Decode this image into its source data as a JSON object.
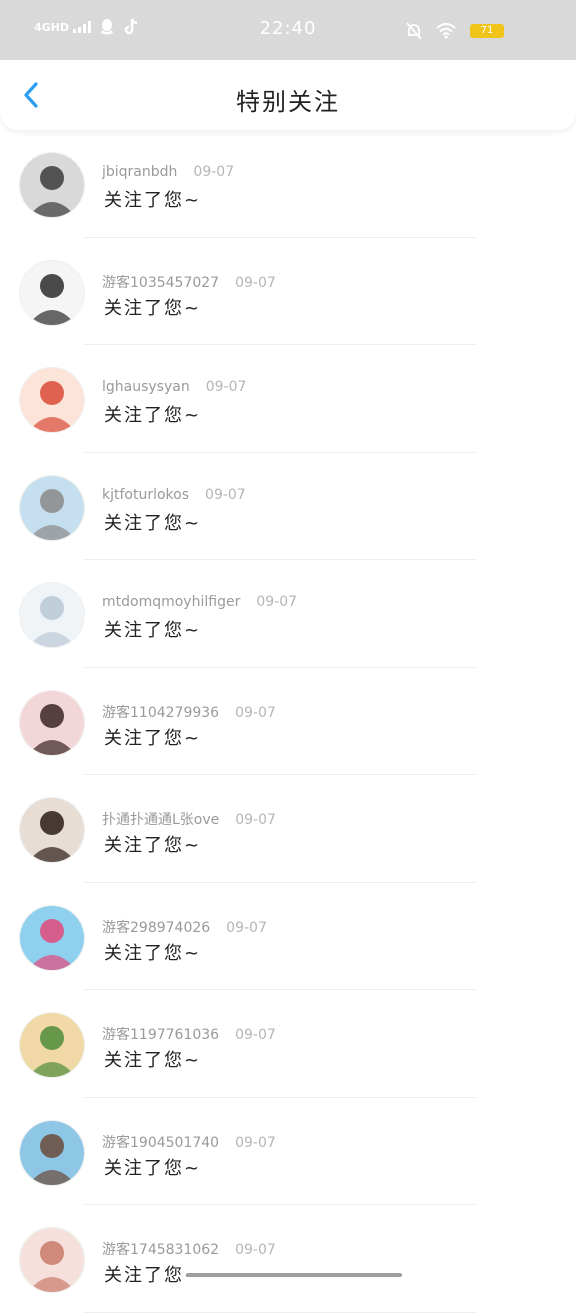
{
  "status_bar": {
    "network": "4GHD",
    "time": "22:40",
    "battery": "71",
    "colors": {
      "bg": "#d9d9d9",
      "battery": "#f0c419"
    }
  },
  "header": {
    "title": "特别关注",
    "accent": "#2a9df4"
  },
  "list": [
    {
      "name": "jbiqranbdh",
      "date": "09-07",
      "message": "关注了您~",
      "avatar_colors": [
        "#d9d9d9",
        "#3a3a3a"
      ]
    },
    {
      "name": "游客1035457027",
      "date": "09-07",
      "message": "关注了您~",
      "avatar_colors": [
        "#f5f5f5",
        "#2b2b2b"
      ]
    },
    {
      "name": "lghausysyan",
      "date": "09-07",
      "message": "关注了您~",
      "avatar_colors": [
        "#fde4d8",
        "#d94b3a"
      ]
    },
    {
      "name": "kjtfoturlokos",
      "date": "09-07",
      "message": "关注了您~",
      "avatar_colors": [
        "#c5dff0",
        "#8a8a8a"
      ]
    },
    {
      "name": "mtdomqmoyhilfiger",
      "date": "09-07",
      "message": "关注了您~",
      "avatar_colors": [
        "#f0f4f7",
        "#b9c8d6"
      ]
    },
    {
      "name": "游客1104279936",
      "date": "09-07",
      "message": "关注了您~",
      "avatar_colors": [
        "#f3d7d8",
        "#3a2424"
      ]
    },
    {
      "name": "扑通扑通通L张ove",
      "date": "09-07",
      "message": "关注了您~",
      "avatar_colors": [
        "#e8ddd4",
        "#2a1c17"
      ]
    },
    {
      "name": "游客298974026",
      "date": "09-07",
      "message": "关注了您~",
      "avatar_colors": [
        "#8fd0ef",
        "#e24a7a"
      ]
    },
    {
      "name": "游客1197761036",
      "date": "09-07",
      "message": "关注了您~",
      "avatar_colors": [
        "#f0d9a6",
        "#4f8c3a"
      ]
    },
    {
      "name": "游客1904501740",
      "date": "09-07",
      "message": "关注了您~",
      "avatar_colors": [
        "#8ec6e6",
        "#6b4a3a"
      ]
    },
    {
      "name": "游客1745831062",
      "date": "09-07",
      "message": "关注了您~",
      "avatar_colors": [
        "#f6e0dc",
        "#c97a6a"
      ]
    }
  ]
}
